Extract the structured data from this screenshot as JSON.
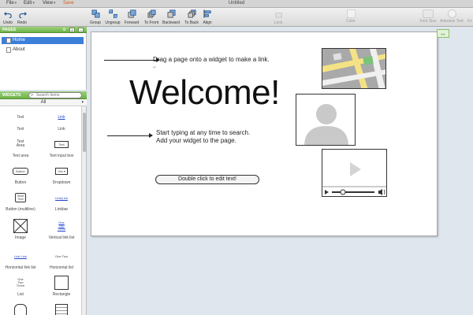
{
  "menubar": {
    "file": "File",
    "edit": "Edit",
    "view": "View",
    "save": "Save",
    "title": "Untitled"
  },
  "toolbar": {
    "undo": "Undo",
    "redo": "Redo",
    "group": "Group",
    "ungroup": "Ungroup",
    "forward": "Forward",
    "to_front": "To Front",
    "backward": "Backward",
    "to_back": "To Back",
    "align": "Align",
    "lock": "Lock",
    "color": "Color",
    "font_size": "Font Size",
    "autosize_text": "Autosize Text",
    "font": "Fo",
    "icon_color": "#2d5f9a",
    "icon_color_dark": "#3a3a3a"
  },
  "pages": {
    "title": "PAGES",
    "items": [
      {
        "label": "Home",
        "selected": true
      },
      {
        "label": "About",
        "selected": false
      }
    ],
    "add": "+",
    "remove": "–"
  },
  "widgets": {
    "title": "WIDGETS",
    "search_placeholder": "Search Items",
    "filter": "All",
    "items": [
      {
        "label": "Text",
        "preview": "Text"
      },
      {
        "label": "Link",
        "preview": "Link"
      },
      {
        "label": "Text area",
        "preview": "Text\nArea"
      },
      {
        "label": "Text input box",
        "preview": "Text"
      },
      {
        "label": "Button",
        "preview": "Button"
      },
      {
        "label": "Dropdown",
        "preview": "Yes"
      },
      {
        "label": "Button (multiline)",
        "preview": "Start\nText"
      },
      {
        "label": "Linkbar",
        "preview": "Link|Link"
      },
      {
        "label": "Image",
        "preview": ""
      },
      {
        "label": "Vertical link list",
        "preview": "One\nTwo\nThree"
      },
      {
        "label": "Horizontal link list",
        "preview": "Link  Link"
      },
      {
        "label": "Horizontal list",
        "preview": "One  Two"
      },
      {
        "label": "List",
        "preview": "One\nTwo\nThree"
      },
      {
        "label": "Rectangle",
        "preview": ""
      }
    ]
  },
  "canvas": {
    "hint_link": "Drag a page onto a widget to make a link.",
    "hint_link_sub": "↵",
    "welcome": "Welcome!",
    "hint_search_line1": "Start typing at any time to search.",
    "hint_search_line2": "Add your widget to the page.",
    "edit_button": "Double click to edit text!",
    "expand_icon": "↔",
    "accent_green": "#6fb247",
    "selection_blue": "#3c7fd9"
  }
}
